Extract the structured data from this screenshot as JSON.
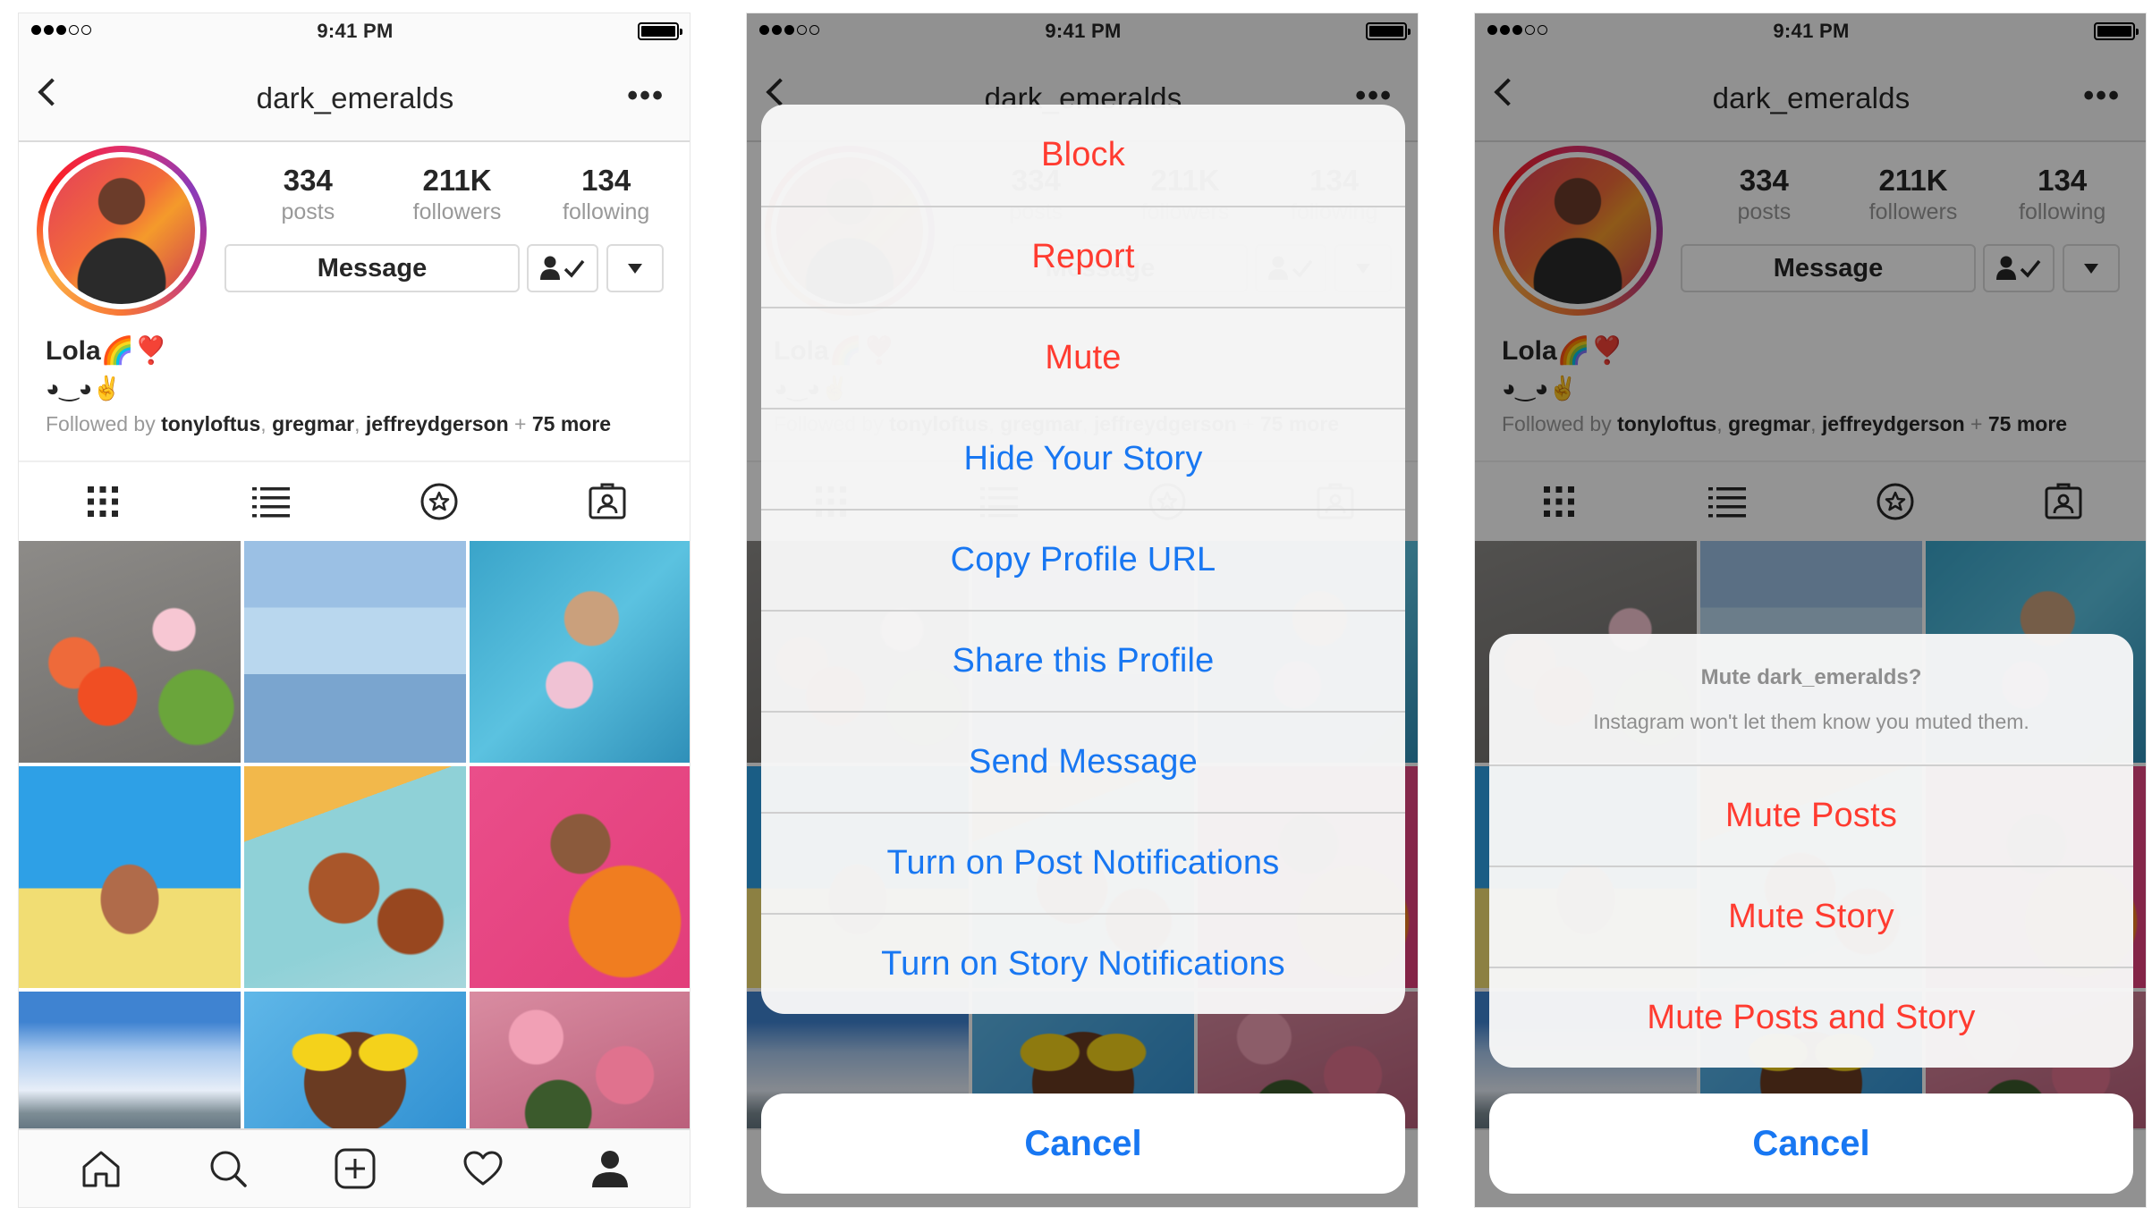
{
  "status": {
    "time": "9:41 PM"
  },
  "profile": {
    "username": "dark_emeralds",
    "stats": [
      {
        "num": "334",
        "label": "posts"
      },
      {
        "num": "211K",
        "label": "followers"
      },
      {
        "num": "134",
        "label": "following"
      }
    ],
    "message_label": "Message",
    "name": "Lola🌈❣️",
    "bio": "◕‿◕✌️",
    "followed_prefix": "Followed by ",
    "followers_shown": [
      "tonyloftus",
      "gregmar",
      "jeffreydgerson"
    ],
    "followed_sep": ", ",
    "followed_plus": " + ",
    "followed_more": "75 more"
  },
  "tabs": [
    "grid-icon",
    "list-icon",
    "tagged-star-icon",
    "saved-person-icon"
  ],
  "bottom_nav": [
    "home-icon",
    "search-icon",
    "add-icon",
    "heart-icon",
    "profile-icon"
  ],
  "action_sheet": {
    "items": [
      {
        "label": "Block",
        "color": "red"
      },
      {
        "label": "Report",
        "color": "red"
      },
      {
        "label": "Mute",
        "color": "red"
      },
      {
        "label": "Hide Your Story",
        "color": "blue"
      },
      {
        "label": "Copy Profile URL",
        "color": "blue"
      },
      {
        "label": "Share this Profile",
        "color": "blue"
      },
      {
        "label": "Send Message",
        "color": "blue"
      },
      {
        "label": "Turn on Post Notifications",
        "color": "blue"
      },
      {
        "label": "Turn on Story Notifications",
        "color": "blue"
      }
    ],
    "cancel": "Cancel"
  },
  "mute_sheet": {
    "title": "Mute dark_emeralds?",
    "message": "Instagram won't let them know you muted them.",
    "items": [
      "Mute Posts",
      "Mute Story",
      "Mute Posts and Story"
    ],
    "cancel": "Cancel"
  },
  "colors": {
    "destructive": "#ff3b30",
    "action": "#1877f2",
    "divider": "#dbdbdb"
  }
}
